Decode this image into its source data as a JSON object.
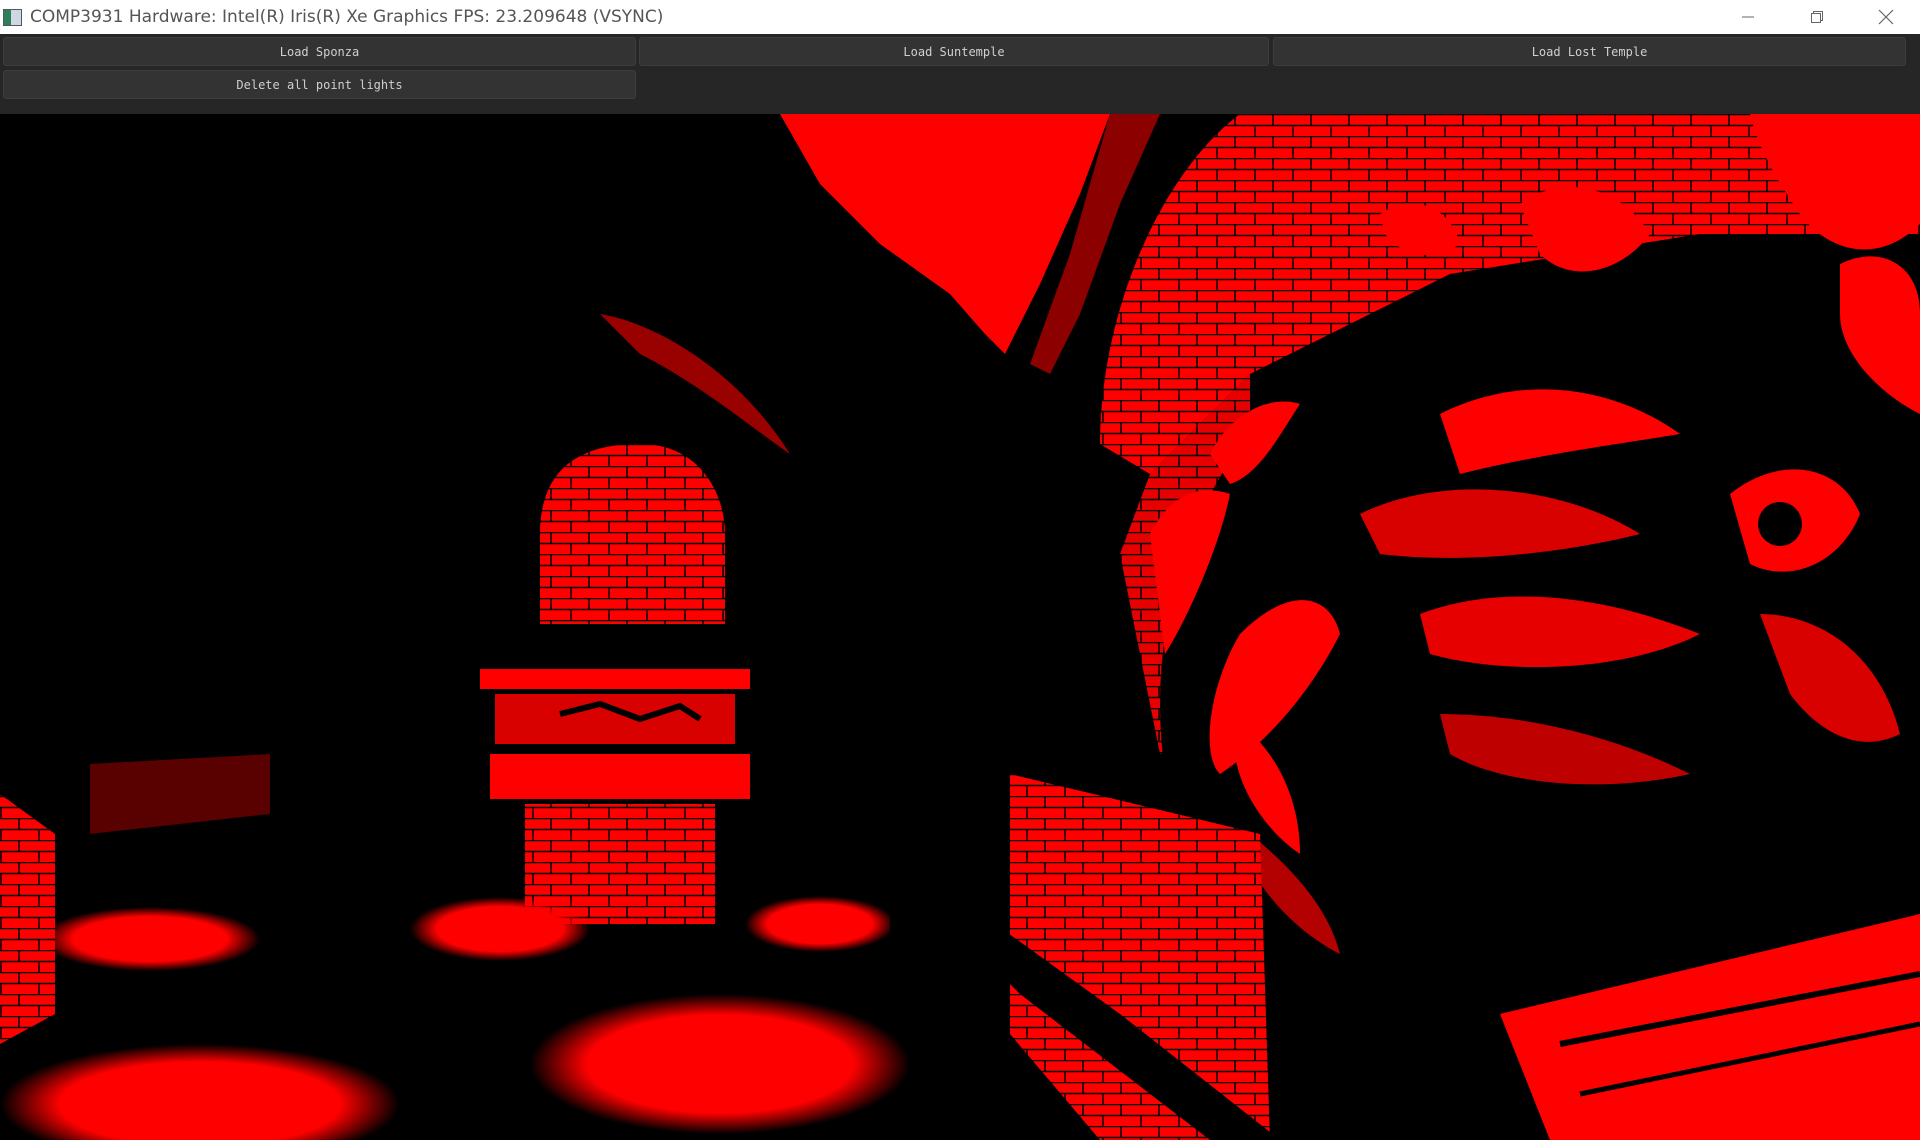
{
  "window": {
    "title": "COMP3931 Hardware: Intel(R) Iris(R) Xe Graphics FPS: 23.209648 (VSYNC)"
  },
  "controls": {
    "minimize_icon": "minimize-icon",
    "restore_icon": "restore-icon",
    "close_icon": "close-icon"
  },
  "toolbar": {
    "load_sponza": "Load Sponza",
    "load_suntemple": "Load Suntemple",
    "load_lost_temple": "Load Lost Temple",
    "delete_point_lights": "Delete all point lights"
  },
  "colors": {
    "render_red": "#ff0000",
    "render_black": "#000000",
    "panel_bg": "#262626",
    "button_bg": "#333333"
  }
}
